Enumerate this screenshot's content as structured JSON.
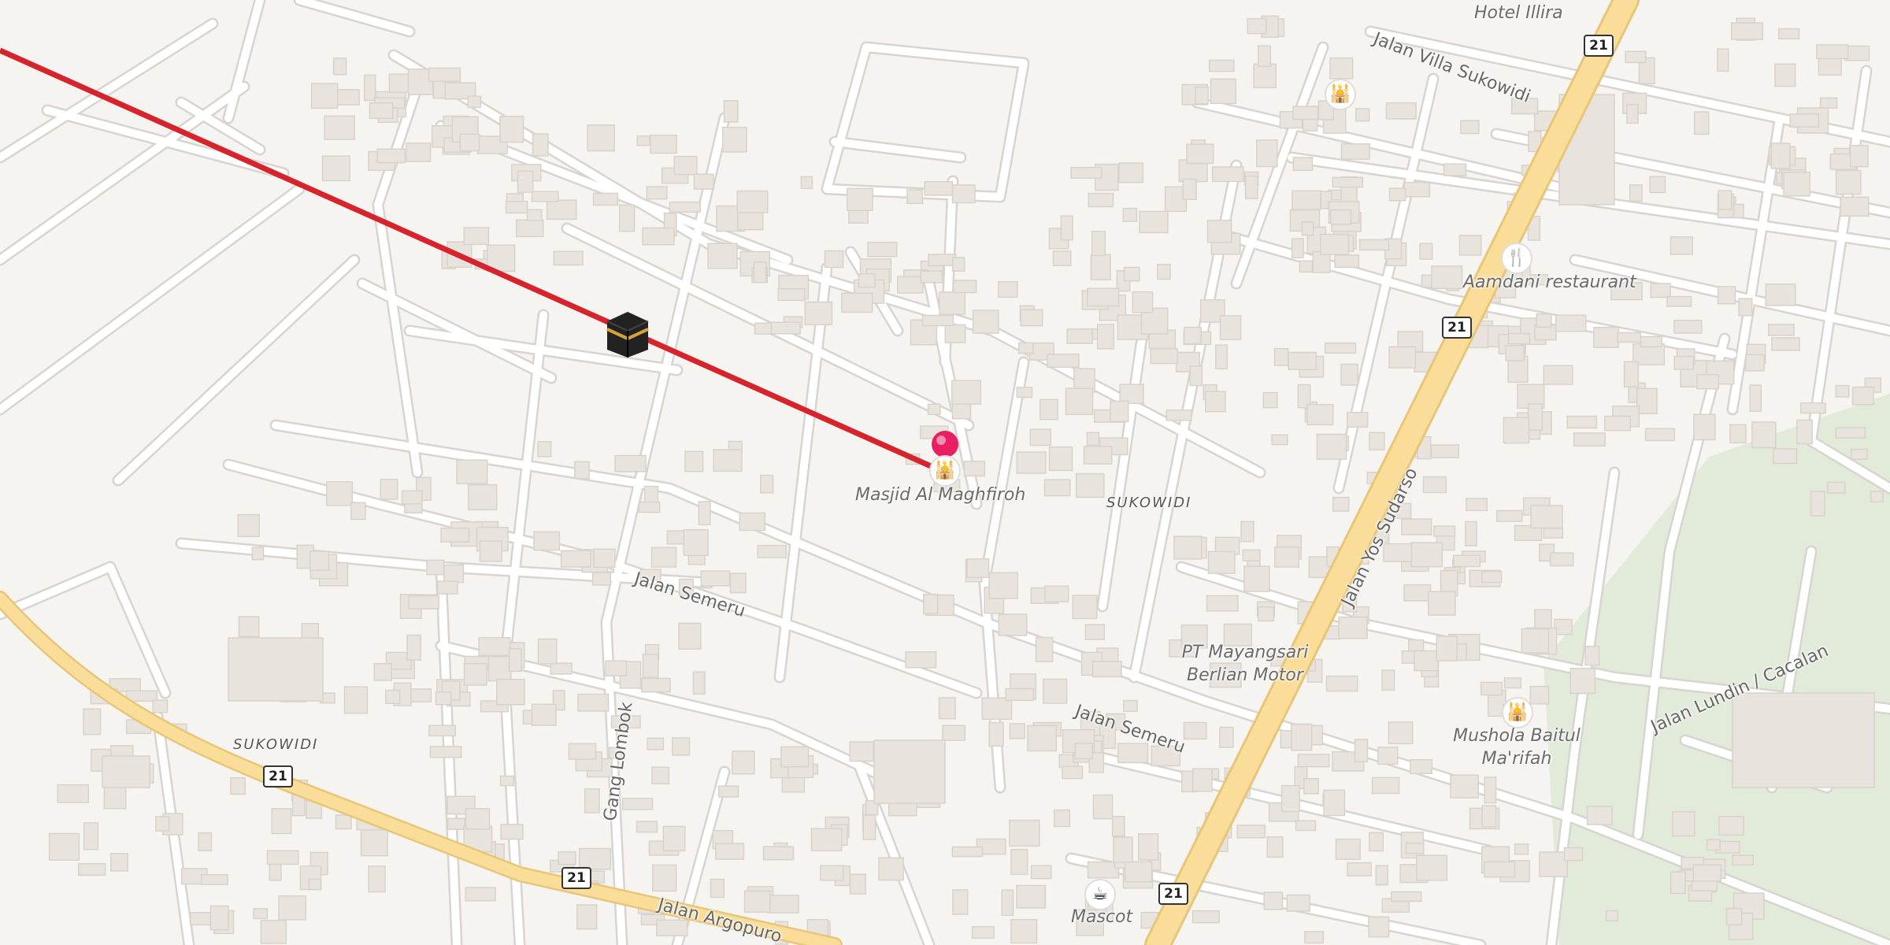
{
  "colors": {
    "background": "#f6f4f1",
    "road": "#ffffff",
    "road_outline": "#d8d4cf",
    "building": "#e8e3dd",
    "building_edge": "#d9d2ca",
    "main_road": "#f9dd98",
    "main_road_edge": "#e7c679",
    "park": "#e2ead9",
    "route_line": "#d6232c",
    "pin": "#e91e63"
  },
  "route": {
    "description_icon": "kaaba-icon",
    "destination_icon": "mosque-icon"
  },
  "streets": [
    {
      "id": "jalan-villa-sukowidi",
      "text": "Jalan Villa Sukowidi"
    },
    {
      "id": "jalan-semeru-1",
      "text": "Jalan Semeru"
    },
    {
      "id": "jalan-semeru-2",
      "text": "Jalan Semeru"
    },
    {
      "id": "jalan-yos-sudarso",
      "text": "Jalan Yos Sudarso"
    },
    {
      "id": "gang-lombok",
      "text": "Gang Lombok"
    },
    {
      "id": "jalan-argopuro",
      "text": "Jalan Argopuro"
    },
    {
      "id": "jalan-lundin",
      "text": "Jalan Lundin / Cacalan"
    }
  ],
  "areas": [
    {
      "id": "sukowidi-1",
      "text": "SUKOWIDI"
    },
    {
      "id": "sukowidi-2",
      "text": "SUKOWIDI"
    }
  ],
  "route_shields": [
    "21",
    "21",
    "21",
    "21",
    "21"
  ],
  "pois": [
    {
      "id": "masjid",
      "name": "Masjid Al Maghfiroh",
      "icon": "mosque-icon"
    },
    {
      "id": "hotel",
      "name": "Hotel Illira",
      "icon": "hotel-icon"
    },
    {
      "id": "aamdani",
      "name": "Aamdani restaurant",
      "icon": "restaurant-icon"
    },
    {
      "id": "mayangsari",
      "name": "PT Mayangsari\nBerlian Motor",
      "icon": ""
    },
    {
      "id": "mushola",
      "name": "Mushola Baitul\nMa'rifah",
      "icon": "mosque-icon"
    },
    {
      "id": "mascot",
      "name": "Mascot",
      "icon": "cafe-icon"
    },
    {
      "id": "villa-mosque",
      "name": "",
      "icon": "mosque-icon"
    }
  ]
}
